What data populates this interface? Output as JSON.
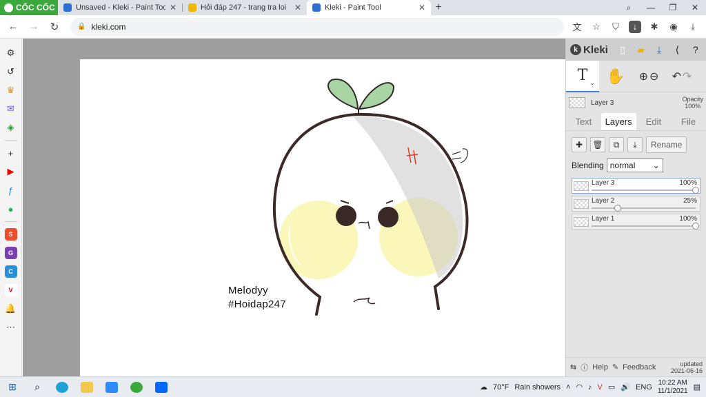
{
  "browser": {
    "brand": "CỐC CỐC",
    "tabs": [
      {
        "title": "Unsaved - Kleki - Paint Tool",
        "favicon_color": "#2a6fd6"
      },
      {
        "title": "Hỏi đáp 247 - trang tra loi",
        "favicon_color": "#f2b705"
      },
      {
        "title": "Kleki - Paint Tool",
        "favicon_color": "#2a6fd6"
      }
    ],
    "url": "kleki.com"
  },
  "canvas": {
    "signature_line1": "Melodyy",
    "signature_line2": "#Hoidap247"
  },
  "kleki": {
    "logo": "Kleki",
    "current_layer": "Layer 3",
    "opacity_label": "Opacity",
    "opacity_value": "100%",
    "tabs": [
      "Text",
      "Layers",
      "Edit",
      "File"
    ],
    "active_tab": "Layers",
    "rename_label": "Rename",
    "blending_label": "Blending",
    "blending_value": "normal",
    "layers": [
      {
        "name": "Layer 3",
        "opacity": "100%",
        "opacity_fraction": 1.0
      },
      {
        "name": "Layer 2",
        "opacity": "25%",
        "opacity_fraction": 0.25
      },
      {
        "name": "Layer 1",
        "opacity": "100%",
        "opacity_fraction": 1.0
      }
    ],
    "help_label": "Help",
    "feedback_label": "Feedback",
    "updated_label": "updated",
    "updated_date": "2021-06-16"
  },
  "taskbar": {
    "weather": "70°F",
    "weather_desc": "Rain showers",
    "language": "ENG",
    "time": "10:22 AM",
    "date": "11/1/2021"
  }
}
